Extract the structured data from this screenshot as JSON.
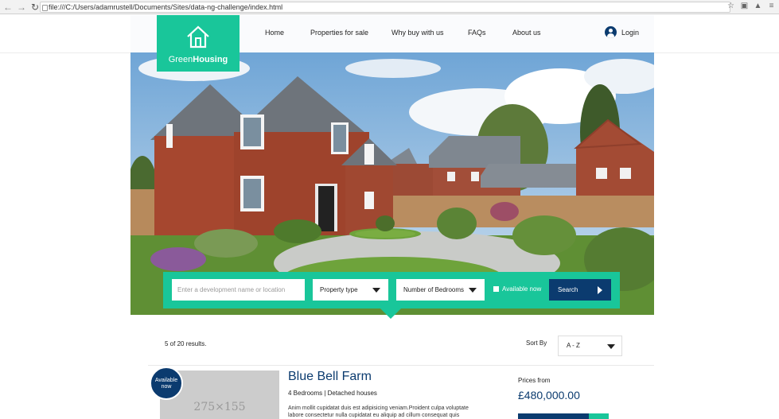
{
  "browser": {
    "url": "file:///C:/Users/adamrustell/Documents/Sites/data-ng-challenge/index.html"
  },
  "brand": {
    "name_light": "Green",
    "name_bold": "Housing",
    "accent_color": "#19c69a",
    "primary_color": "#0b3b6f"
  },
  "nav": {
    "items": [
      {
        "label": "Home"
      },
      {
        "label": "Properties for sale"
      },
      {
        "label": "Why buy with us"
      },
      {
        "label": "FAQs"
      },
      {
        "label": "About us"
      }
    ],
    "login_label": "Login"
  },
  "search": {
    "placeholder": "Enter a development name or location",
    "property_type_label": "Property type",
    "bedrooms_label": "Number of Bedrooms",
    "available_label": "Available now",
    "search_label": "Search"
  },
  "results": {
    "count_text": "5 of 20 results.",
    "sort_label": "Sort By",
    "sort_value": "A - Z"
  },
  "listing": {
    "badge_line1": "Available",
    "badge_line2": "now",
    "image_placeholder": "275×155",
    "title": "Blue Bell Farm",
    "subtitle": "4 Bedrooms | Detached houses",
    "description": "Anim mollit cupidatat duis est adipisicing veniam.Proident culpa voluptate labore consectetur nulla cupidatat eu aliquip ad cillum consequat quis",
    "prices_from_label": "Prices from",
    "price": "£480,000.00"
  }
}
